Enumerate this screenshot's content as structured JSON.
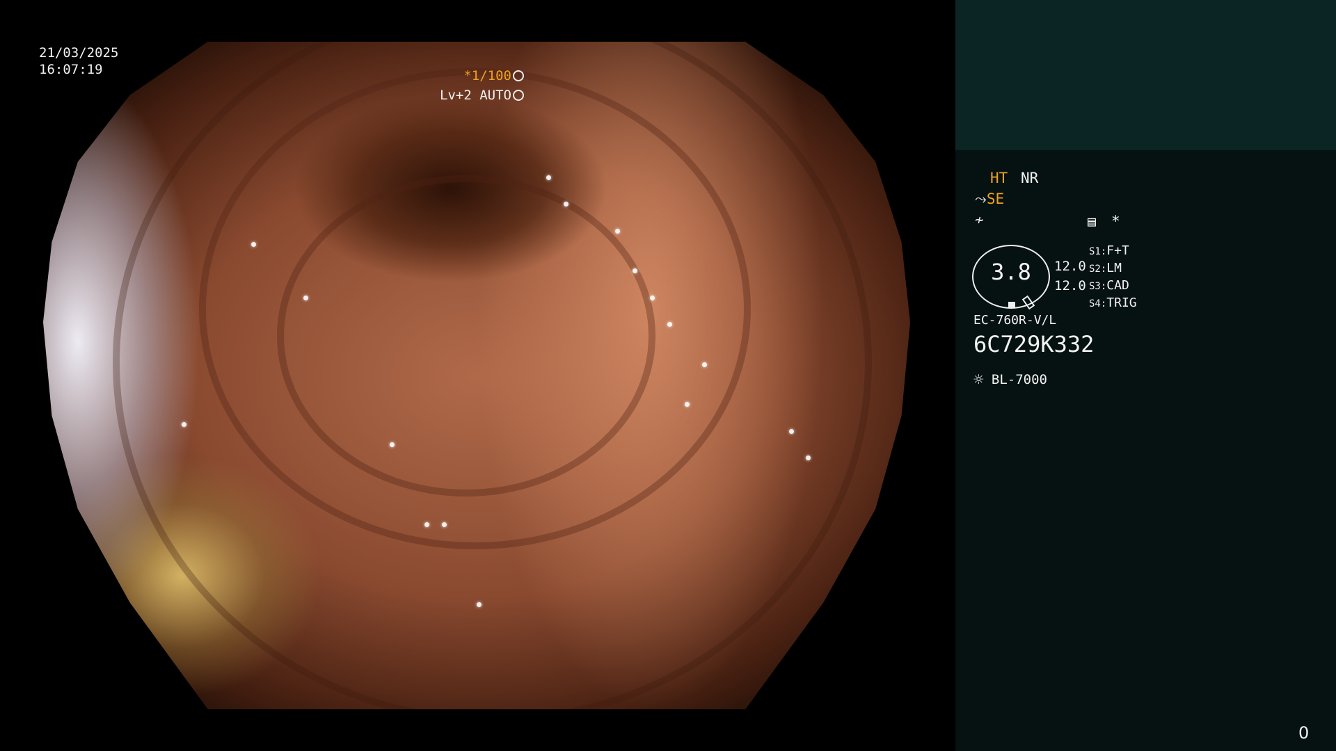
{
  "overlay": {
    "date": "21/03/2025",
    "time": "16:07:19",
    "shutter": "*1/100",
    "level": "Lv+2 AUTO"
  },
  "panel": {
    "ht": "HT",
    "nr": "NR",
    "se": "SE",
    "gauge_value": "3.8",
    "sharpness_1": "12.0",
    "sharpness_2": "12.0",
    "switches": [
      {
        "key": "S1:",
        "value": "F+T"
      },
      {
        "key": "S2:",
        "value": "LM"
      },
      {
        "key": "S3:",
        "value": "CAD"
      },
      {
        "key": "S4:",
        "value": "TRIG"
      }
    ],
    "scope_model": "EC-760R-V/L",
    "serial": "6C729K332",
    "light_source": "BL-7000",
    "asterisk": "*"
  },
  "frame_count": "0",
  "colors": {
    "panel_bg": "#061212",
    "panel_top_bg": "#0b2424",
    "accent_orange": "#f0a020",
    "text": "#f2f2f2"
  },
  "icons": [
    "shutter-icon",
    "auto-icon",
    "scope-angle-icon",
    "enhance-icon",
    "memo-icon",
    "gauge-icon",
    "light-source-icon"
  ]
}
